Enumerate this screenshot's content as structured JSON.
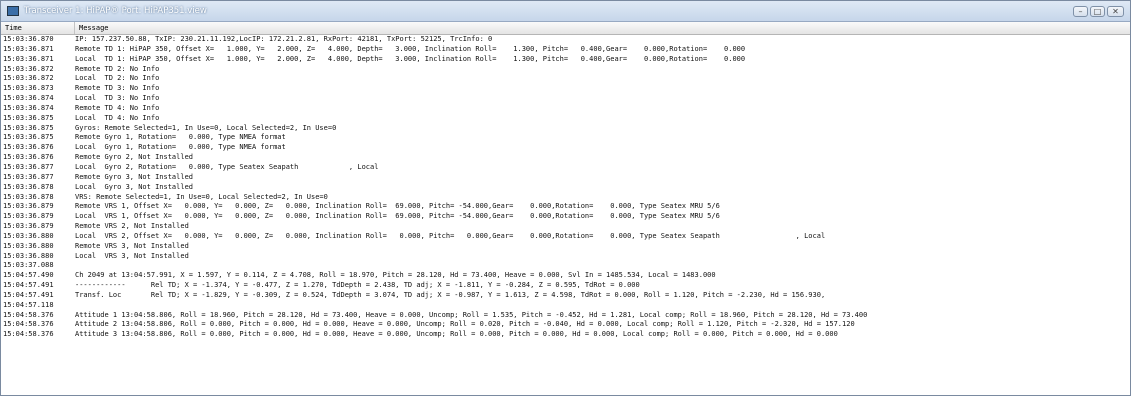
{
  "window": {
    "title": "Transceiver 1: HiPAP® Port: HiPAP351.view",
    "controls": {
      "minimize": "–",
      "maximize": "□",
      "close": "✕"
    }
  },
  "columns": {
    "time": "Time",
    "message": "Message"
  },
  "rows": [
    {
      "time": "15:03:36.870",
      "message": "IP: 157.237.50.88, TxIP: 230.21.11.192,LocIP: 172.21.2.81, RxPort: 42181, TxPort: 52125, TrcInfo: 0"
    },
    {
      "time": "15:03:36.871",
      "message": "Remote TD 1: HiPAP 350, Offset X=   1.000, Y=   2.000, Z=   4.000, Depth=   3.000, Inclination Roll=    1.300, Pitch=   0.400,Gear=    0.000,Rotation=    0.000"
    },
    {
      "time": "15:03:36.871",
      "message": "Local  TD 1: HiPAP 350, Offset X=   1.000, Y=   2.000, Z=   4.000, Depth=   3.000, Inclination Roll=    1.300, Pitch=   0.400,Gear=    0.000,Rotation=    0.000"
    },
    {
      "time": "15:03:36.872",
      "message": "Remote TD 2: No Info"
    },
    {
      "time": "15:03:36.872",
      "message": "Local  TD 2: No Info"
    },
    {
      "time": "15:03:36.873",
      "message": "Remote TD 3: No Info"
    },
    {
      "time": "15:03:36.874",
      "message": "Local  TD 3: No Info"
    },
    {
      "time": "15:03:36.874",
      "message": "Remote TD 4: No Info"
    },
    {
      "time": "15:03:36.875",
      "message": "Local  TD 4: No Info"
    },
    {
      "time": "15:03:36.875",
      "message": "Gyros: Remote Selected=1, In Use=0, Local Selected=2, In Use=0"
    },
    {
      "time": "15:03:36.875",
      "message": "Remote Gyro 1, Rotation=   0.000, Type NMEA format"
    },
    {
      "time": "15:03:36.876",
      "message": "Local  Gyro 1, Rotation=   0.000, Type NMEA format"
    },
    {
      "time": "15:03:36.876",
      "message": "Remote Gyro 2, Not Installed"
    },
    {
      "time": "15:03:36.877",
      "message": "Local  Gyro 2, Rotation=   0.000, Type Seatex Seapath            , Local"
    },
    {
      "time": "15:03:36.877",
      "message": "Remote Gyro 3, Not Installed"
    },
    {
      "time": "15:03:36.878",
      "message": "Local  Gyro 3, Not Installed"
    },
    {
      "time": "15:03:36.878",
      "message": "VRS: Remote Selected=1, In Use=0, Local Selected=2, In Use=0"
    },
    {
      "time": "15:03:36.879",
      "message": "Remote VRS 1, Offset X=   0.000, Y=   0.000, Z=   0.000, Inclination Roll=  69.000, Pitch= -54.000,Gear=    0.000,Rotation=    0.000, Type Seatex MRU 5/6"
    },
    {
      "time": "15:03:36.879",
      "message": "Local  VRS 1, Offset X=   0.000, Y=   0.000, Z=   0.000, Inclination Roll=  69.000, Pitch= -54.000,Gear=    0.000,Rotation=    0.000, Type Seatex MRU 5/6"
    },
    {
      "time": "15:03:36.879",
      "message": "Remote VRS 2, Not Installed"
    },
    {
      "time": "15:03:36.880",
      "message": "Local  VRS 2, Offset X=   0.000, Y=   0.000, Z=   0.000, Inclination Roll=   0.000, Pitch=   0.000,Gear=    0.000,Rotation=    0.000, Type Seatex Seapath                  , Local"
    },
    {
      "time": "15:03:36.880",
      "message": "Remote VRS 3, Not Installed"
    },
    {
      "time": "15:03:36.880",
      "message": "Local  VRS 3, Not Installed"
    },
    {
      "time": "15:03:37.088",
      "message": ""
    },
    {
      "time": "15:04:57.490",
      "message": "Ch 2049 at 13:04:57.991, X = 1.597, Y = 0.114, Z = 4.708, Roll = 18.970, Pitch = 28.120, Hd = 73.400, Heave = 0.000, Svl In = 1485.534, Local = 1483.000"
    },
    {
      "time": "15:04:57.491",
      "message": "------------      Rel TD; X = -1.374, Y = -0.477, Z = 1.270, TdDepth = 2.438, TD adj; X = -1.811, Y = -0.284, Z = 0.595, TdRot = 0.000"
    },
    {
      "time": "15:04:57.491",
      "message": "Transf. Loc       Rel TD; X = -1.829, Y = -0.309, Z = 0.524, TdDepth = 3.074, TD adj; X = -0.987, Y = 1.613, Z = 4.598, TdRot = 0.000, Roll = 1.120, Pitch = -2.230, Hd = 156.930,"
    },
    {
      "time": "15:04:57.118",
      "message": ""
    },
    {
      "time": "15:04:58.376",
      "message": "Attitude 1 13:04:58.806, Roll = 18.960, Pitch = 28.120, Hd = 73.400, Heave = 0.000, Uncomp; Roll = 1.535, Pitch = -0.452, Hd = 1.281, Local comp; Roll = 18.960, Pitch = 28.120, Hd = 73.400"
    },
    {
      "time": "15:04:58.376",
      "message": "Attitude 2 13:04:58.806, Roll = 0.000, Pitch = 0.000, Hd = 0.000, Heave = 0.000, Uncomp; Roll = 0.020, Pitch = -0.040, Hd = 0.000, Local comp; Roll = 1.120, Pitch = -2.320, Hd = 157.120"
    },
    {
      "time": "15:04:58.376",
      "message": "Attitude 3 13:04:58.806, Roll = 0.000, Pitch = 0.000, Hd = 0.000, Heave = 0.000, Uncomp; Roll = 0.000, Pitch = 0.000, Hd = 0.000, Local comp; Roll = 0.000, Pitch = 0.000, Hd = 0.000"
    }
  ]
}
